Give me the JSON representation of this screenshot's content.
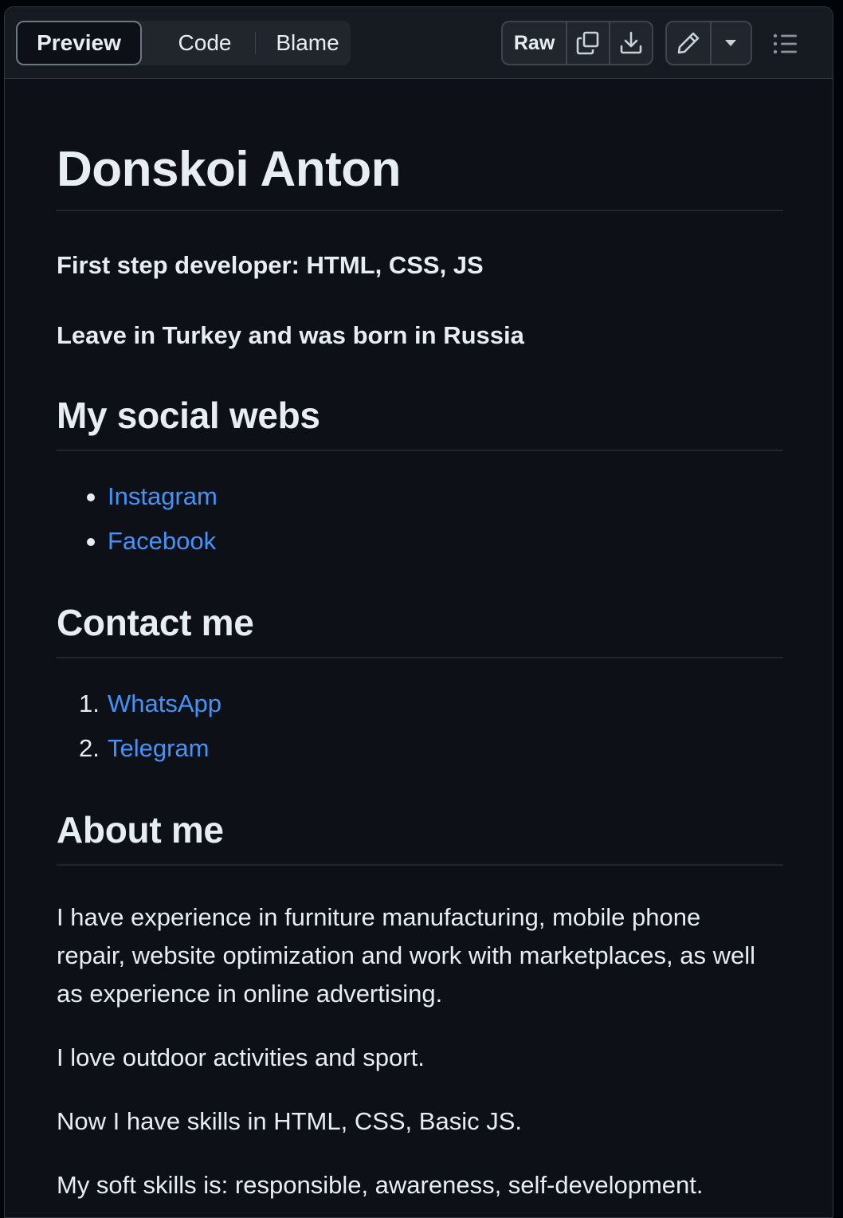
{
  "toolbar": {
    "tabs": [
      {
        "label": "Preview",
        "active": true
      },
      {
        "label": "Code",
        "active": false
      },
      {
        "label": "Blame",
        "active": false
      }
    ],
    "raw_label": "Raw",
    "icons": {
      "copy": "copy-icon",
      "download": "download-icon",
      "edit": "pencil-icon",
      "more": "triangle-down-icon",
      "outline": "list-unordered-icon"
    }
  },
  "readme": {
    "title": "Donskoi Anton",
    "intro_lines": [
      "First step developer: HTML, CSS, JS",
      "Leave in Turkey and was born in Russia"
    ],
    "social": {
      "heading": "My social webs",
      "links": [
        "Instagram",
        "Facebook"
      ]
    },
    "contact": {
      "heading": "Contact me",
      "links": [
        "WhatsApp",
        "Telegram"
      ]
    },
    "about": {
      "heading": "About me",
      "paragraphs": [
        "I have experience in furniture manufacturing, mobile phone repair, website optimization and work with marketplaces, as well as experience in online advertising.",
        "I love outdoor activities and sport.",
        "Now I have skills in HTML, CSS, Basic JS.",
        "My soft skills is: responsible, awareness, self-development."
      ]
    }
  },
  "colors": {
    "background": "#0d1117",
    "toolbar": "#161b22",
    "text": "#e6edf3",
    "link": "#4493f8",
    "border": "#30363d"
  }
}
